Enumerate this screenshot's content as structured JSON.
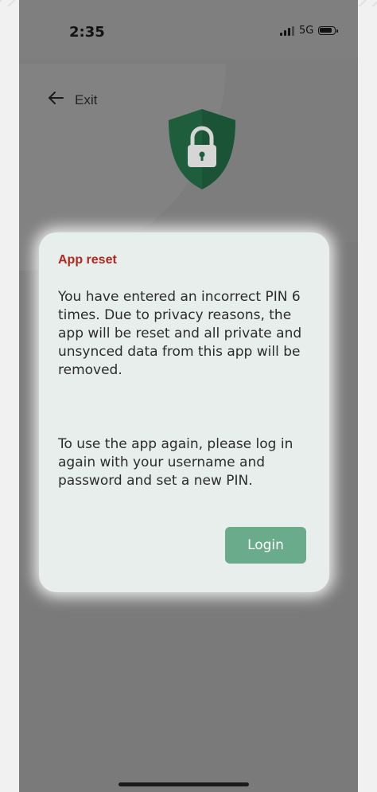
{
  "status_bar": {
    "time": "2:35",
    "network": "5G"
  },
  "header": {
    "back_label": "Exit"
  },
  "icons": {
    "back": "arrow-left-icon",
    "hero": "shield-lock-icon",
    "signal": "signal-bars-icon",
    "battery": "battery-icon"
  },
  "dialog": {
    "title": "App reset",
    "paragraph_1": "You have entered an incorrect PIN 6 times. Due to privacy reasons, the app will be reset and all private and unsynced data from this app will be removed.",
    "paragraph_2": "To use the app again, please log in again with your username and password and set a new PIN.",
    "button_label": "Login"
  },
  "colors": {
    "title": "#b3261e",
    "button": "#6aab8c",
    "shield": "#1f5e3d"
  }
}
